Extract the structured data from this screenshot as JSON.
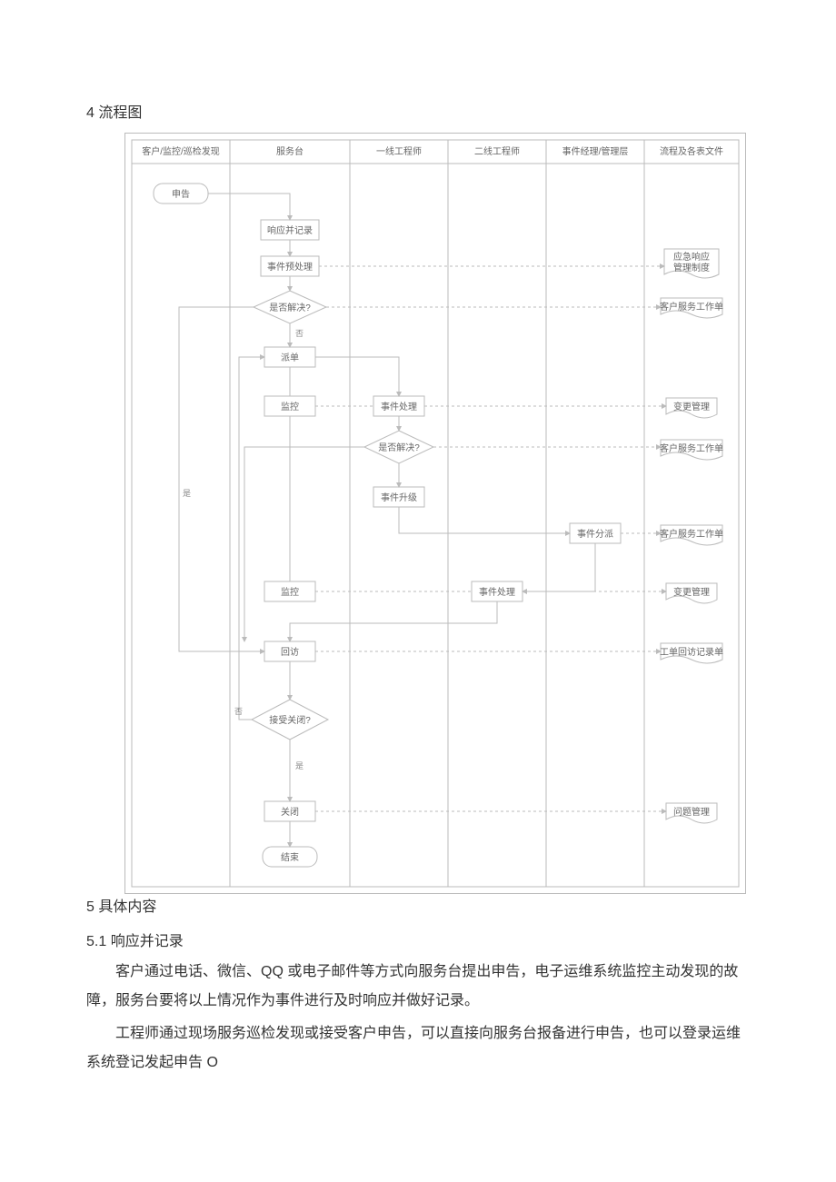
{
  "headings": {
    "h4": "4 流程图",
    "h5": "5 具体内容",
    "h5_1": "5.1 响应并记录"
  },
  "paragraphs": {
    "p1": "客户通过电话、微信、QQ 或电子邮件等方式向服务台提出申告，电子运维系统监控主动发现的故障，服务台要将以上情况作为事件进行及时响应并做好记录。",
    "p2": "工程师通过现场服务巡检发现或接受客户申告，可以直接向服务台报备进行申告，也可以登录运维系统登记发起申告 O"
  },
  "diagram": {
    "lanes": [
      "客户/监控/巡检发现",
      "服务台",
      "一线工程师",
      "二线工程师",
      "事件经理/管理层",
      "流程及各表文件"
    ],
    "nodes": {
      "start": "申告",
      "respond": "响应并记录",
      "pre": "事件预处理",
      "solved1": "是否解决?",
      "dispatch": "派单",
      "monitor1": "监控",
      "handle1": "事件处理",
      "solved2": "是否解决?",
      "escalate": "事件升级",
      "assign": "事件分派",
      "monitor2": "监控",
      "handle2": "事件处理",
      "visit": "回访",
      "close_q": "接受关闭?",
      "close": "关闭",
      "end": "结束",
      "doc_emerg": "应急响应\n管理制度",
      "doc_svc1": "客户服务工作单",
      "doc_chg1": "变更管理",
      "doc_svc2": "客户服务工作单",
      "doc_svc3": "客户服务工作单",
      "doc_chg2": "变更管理",
      "doc_visit": "工单回访记录单",
      "doc_issue": "问题管理"
    },
    "edge_labels": {
      "yes": "是",
      "no": "否"
    }
  }
}
